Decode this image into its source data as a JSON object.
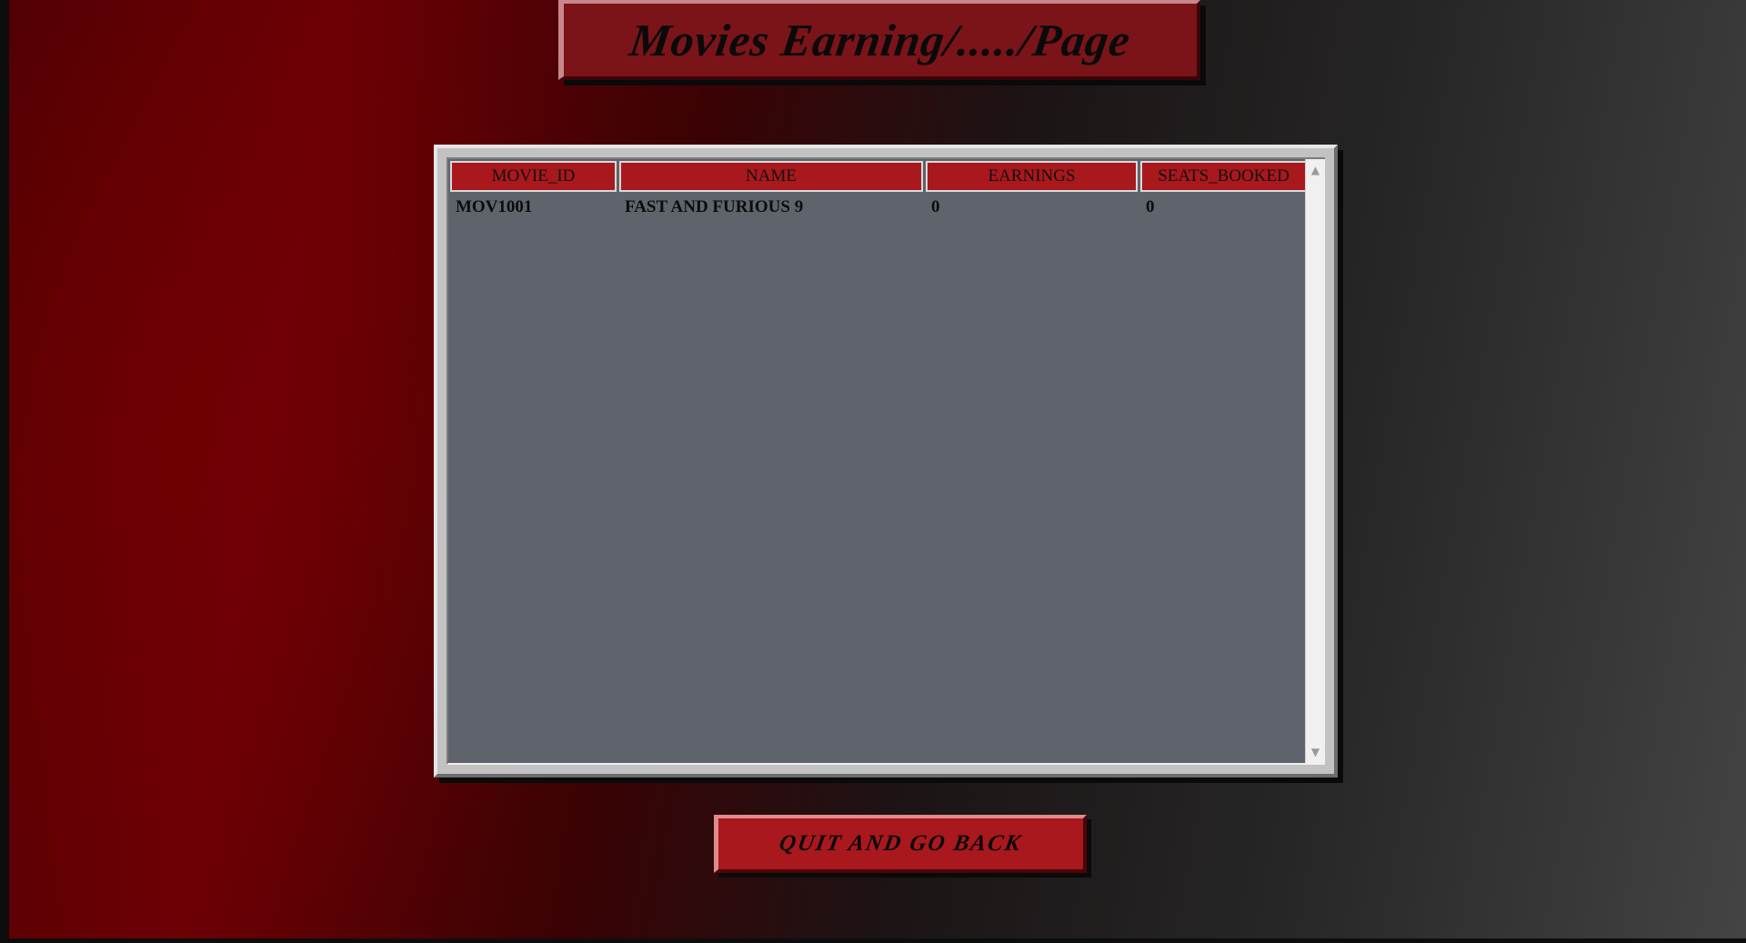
{
  "page": {
    "title": "Movies Earning/...../Page"
  },
  "table": {
    "columns": [
      "MOVIE_ID",
      "NAME",
      "EARNINGS",
      "SEATS_BOOKED"
    ],
    "rows": [
      [
        "MOV1001",
        "FAST AND FURIOUS 9",
        "0",
        "0"
      ]
    ]
  },
  "scrollbar": {
    "up_icon": "▲",
    "down_icon": "▼"
  },
  "actions": {
    "quit_label": "QUIT AND GO BACK"
  },
  "colors": {
    "accent_red": "#a8181d",
    "table_bg": "#5f636b",
    "banner_red": "#7a1419"
  }
}
